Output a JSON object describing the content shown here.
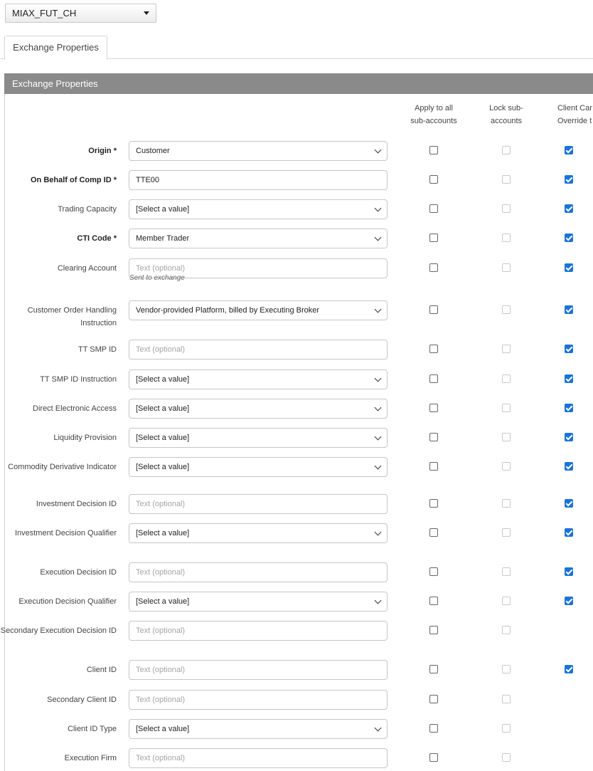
{
  "exchange_select": {
    "value": "MIAX_FUT_CH",
    "icon": "caret-down-icon"
  },
  "tabs": [
    {
      "label": "Exchange Properties"
    }
  ],
  "panel": {
    "title": "Exchange Properties"
  },
  "columns": {
    "apply": "Apply to all\nsub-accounts",
    "lock": "Lock sub-\naccounts",
    "client": "Client Car\nOverride t"
  },
  "colors": {
    "header_bg": "#8a8a8a",
    "checkbox_checked": "#1a73d9"
  },
  "fields": [
    {
      "label": "Origin *",
      "required": true,
      "type": "select",
      "value": "Customer",
      "apply": false,
      "lock": false,
      "client": true
    },
    {
      "label": "On Behalf of Comp ID *",
      "required": true,
      "type": "text",
      "value": "TTE00",
      "apply": false,
      "lock": false,
      "client": true
    },
    {
      "label": "Trading Capacity",
      "type": "select",
      "value": "[Select a value]",
      "apply": false,
      "lock": false,
      "client": true
    },
    {
      "label": "CTI Code *",
      "required": true,
      "type": "select",
      "value": "Member Trader",
      "apply": false,
      "lock": false,
      "client": true
    },
    {
      "label": "Clearing Account",
      "type": "text",
      "value": "",
      "placeholder": "Text (optional)",
      "hint": "Sent to exchange",
      "apply": false,
      "lock": false,
      "client": true
    },
    {
      "label": "Customer Order Handling Instruction",
      "type": "select",
      "value": "Vendor-provided Platform, billed by Executing Broker",
      "apply": false,
      "lock": false,
      "client": true
    },
    {
      "label": "TT SMP ID",
      "type": "text",
      "value": "",
      "placeholder": "Text (optional)",
      "apply": false,
      "lock": false,
      "client": true
    },
    {
      "label": "TT SMP ID Instruction",
      "type": "select",
      "value": "[Select a value]",
      "apply": false,
      "lock": false,
      "client": true
    },
    {
      "label": "Direct Electronic Access",
      "type": "select",
      "value": "[Select a value]",
      "apply": false,
      "lock": false,
      "client": true
    },
    {
      "label": "Liquidity Provision",
      "type": "select",
      "value": "[Select a value]",
      "apply": false,
      "lock": false,
      "client": true
    },
    {
      "label": "Commodity Derivative Indicator",
      "type": "select",
      "value": "[Select a value]",
      "apply": false,
      "lock": false,
      "client": true
    },
    {
      "label": "Investment Decision ID",
      "type": "text",
      "value": "",
      "placeholder": "Text (optional)",
      "apply": false,
      "lock": false,
      "client": true
    },
    {
      "label": "Investment Decision Qualifier",
      "type": "select",
      "value": "[Select a value]",
      "apply": false,
      "lock": false,
      "client": true
    },
    {
      "label": "Execution Decision ID",
      "type": "text",
      "value": "",
      "placeholder": "Text (optional)",
      "apply": false,
      "lock": false,
      "client": true
    },
    {
      "label": "Execution Decision Qualifier",
      "type": "select",
      "value": "[Select a value]",
      "apply": false,
      "lock": false,
      "client": true
    },
    {
      "label": "Secondary Execution Decision ID",
      "type": "text",
      "value": "",
      "placeholder": "Text (optional)",
      "apply": false,
      "lock": false,
      "client": null
    },
    {
      "label": "Client ID",
      "type": "text",
      "value": "",
      "placeholder": "Text (optional)",
      "apply": false,
      "lock": false,
      "client": true
    },
    {
      "label": "Secondary Client ID",
      "type": "text",
      "value": "",
      "placeholder": "Text (optional)",
      "apply": false,
      "lock": false,
      "client": null
    },
    {
      "label": "Client ID Type",
      "type": "select",
      "value": "[Select a value]",
      "apply": false,
      "lock": false,
      "client": null
    },
    {
      "label": "Execution Firm",
      "type": "text",
      "value": "",
      "placeholder": "Text (optional)",
      "apply": false,
      "lock": false,
      "client": null
    }
  ]
}
